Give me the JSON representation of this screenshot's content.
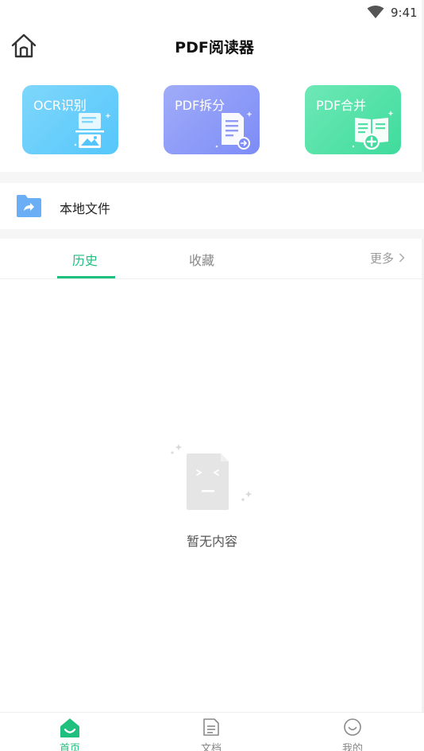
{
  "status_bar": {
    "time": "9:41",
    "wifi_icon": "wifi-icon"
  },
  "header": {
    "title": "PDF阅读器",
    "home_icon": "home-icon"
  },
  "tools": [
    {
      "label": "OCR识别",
      "icon": "ocr-scan-icon",
      "color": "#55c6fb"
    },
    {
      "label": "PDF拆分",
      "icon": "pdf-split-icon",
      "color": "#7d8cf7"
    },
    {
      "label": "PDF合并",
      "icon": "pdf-merge-icon",
      "color": "#3fdc9c"
    }
  ],
  "local_file": {
    "label": "本地文件",
    "icon": "folder-share-icon",
    "color": "#5aa8f5"
  },
  "tabs": {
    "items": [
      {
        "label": "历史",
        "active": true
      },
      {
        "label": "收藏",
        "active": false
      }
    ],
    "more_label": "更多",
    "accent": "#1fbf7e"
  },
  "empty_state": {
    "text": "暂无内容",
    "icon": "empty-document-icon"
  },
  "bottom_nav": [
    {
      "label": "首页",
      "icon": "home-filled-icon",
      "active": true
    },
    {
      "label": "文档",
      "icon": "document-icon",
      "active": false
    },
    {
      "label": "我的",
      "icon": "smile-profile-icon",
      "active": false
    }
  ]
}
